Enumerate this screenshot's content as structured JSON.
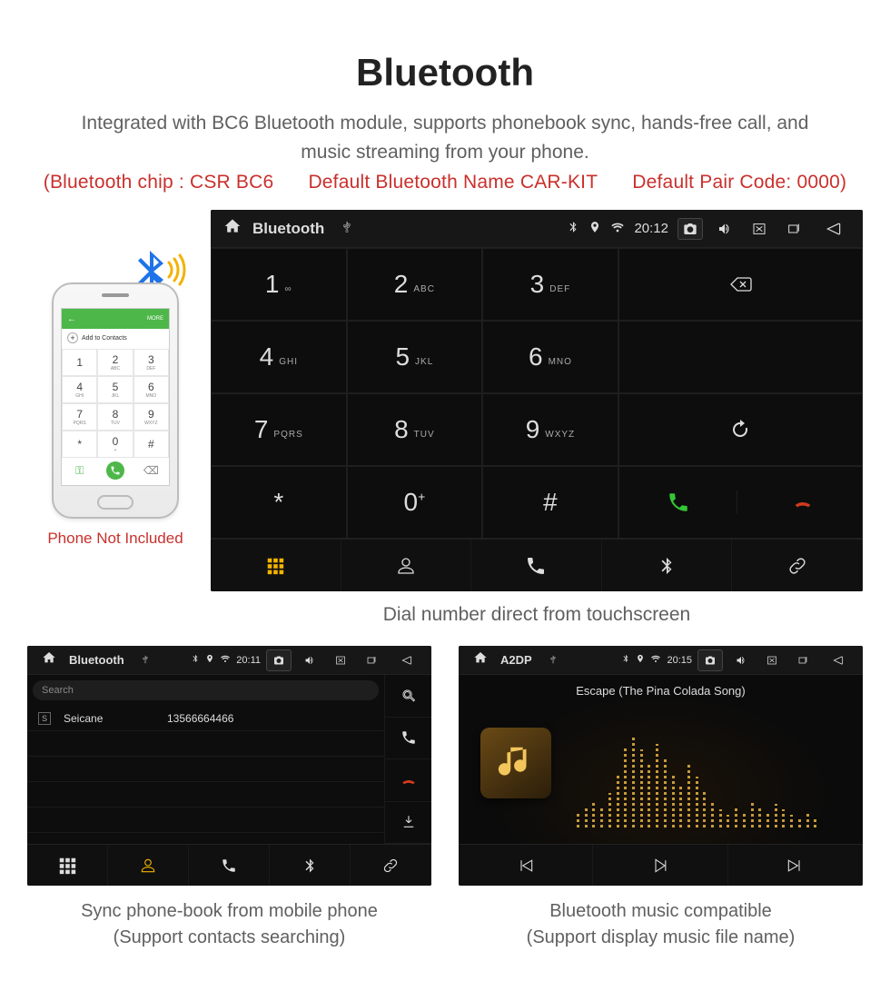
{
  "title": "Bluetooth",
  "subtitle": "Integrated with BC6 Bluetooth module, supports phonebook sync, hands-free call, and music streaming from your phone.",
  "spec": {
    "chip": "(Bluetooth chip : CSR BC6",
    "name": "Default Bluetooth Name CAR-KIT",
    "pair": "Default Pair Code: 0000)"
  },
  "phone": {
    "caption": "Phone Not Included",
    "topbar_add": "Add to Contacts",
    "topbar_more": "MORE",
    "keys": [
      {
        "d": "1",
        "l": ""
      },
      {
        "d": "2",
        "l": "ABC"
      },
      {
        "d": "3",
        "l": "DEF"
      },
      {
        "d": "4",
        "l": "GHI"
      },
      {
        "d": "5",
        "l": "JKL"
      },
      {
        "d": "6",
        "l": "MNO"
      },
      {
        "d": "7",
        "l": "PQRS"
      },
      {
        "d": "8",
        "l": "TUV"
      },
      {
        "d": "9",
        "l": "WXYZ"
      },
      {
        "d": "*",
        "l": ""
      },
      {
        "d": "0",
        "l": "+"
      },
      {
        "d": "#",
        "l": ""
      }
    ]
  },
  "dialer": {
    "statusbar": {
      "title": "Bluetooth",
      "clock": "20:12"
    },
    "keys": [
      {
        "n": "1",
        "s": "∞"
      },
      {
        "n": "2",
        "s": "ABC"
      },
      {
        "n": "3",
        "s": "DEF"
      },
      {
        "n": "4",
        "s": "GHI"
      },
      {
        "n": "5",
        "s": "JKL"
      },
      {
        "n": "6",
        "s": "MNO"
      },
      {
        "n": "7",
        "s": "PQRS"
      },
      {
        "n": "8",
        "s": "TUV"
      },
      {
        "n": "9",
        "s": "WXYZ"
      },
      {
        "n": "*",
        "s": ""
      },
      {
        "n": "0",
        "s": "+"
      },
      {
        "n": "#",
        "s": ""
      }
    ],
    "caption": "Dial number direct from touchscreen"
  },
  "contacts": {
    "statusbar": {
      "title": "Bluetooth",
      "clock": "20:11"
    },
    "search_placeholder": "Search",
    "entry": {
      "initial": "S",
      "name": "Seicane",
      "number": "13566664466"
    },
    "caption_line1": "Sync phone-book from mobile phone",
    "caption_line2": "(Support contacts searching)"
  },
  "music": {
    "statusbar": {
      "title": "A2DP",
      "clock": "20:15"
    },
    "track": "Escape (The Pina Colada Song)",
    "caption_line1": "Bluetooth music compatible",
    "caption_line2": "(Support display music file name)"
  }
}
